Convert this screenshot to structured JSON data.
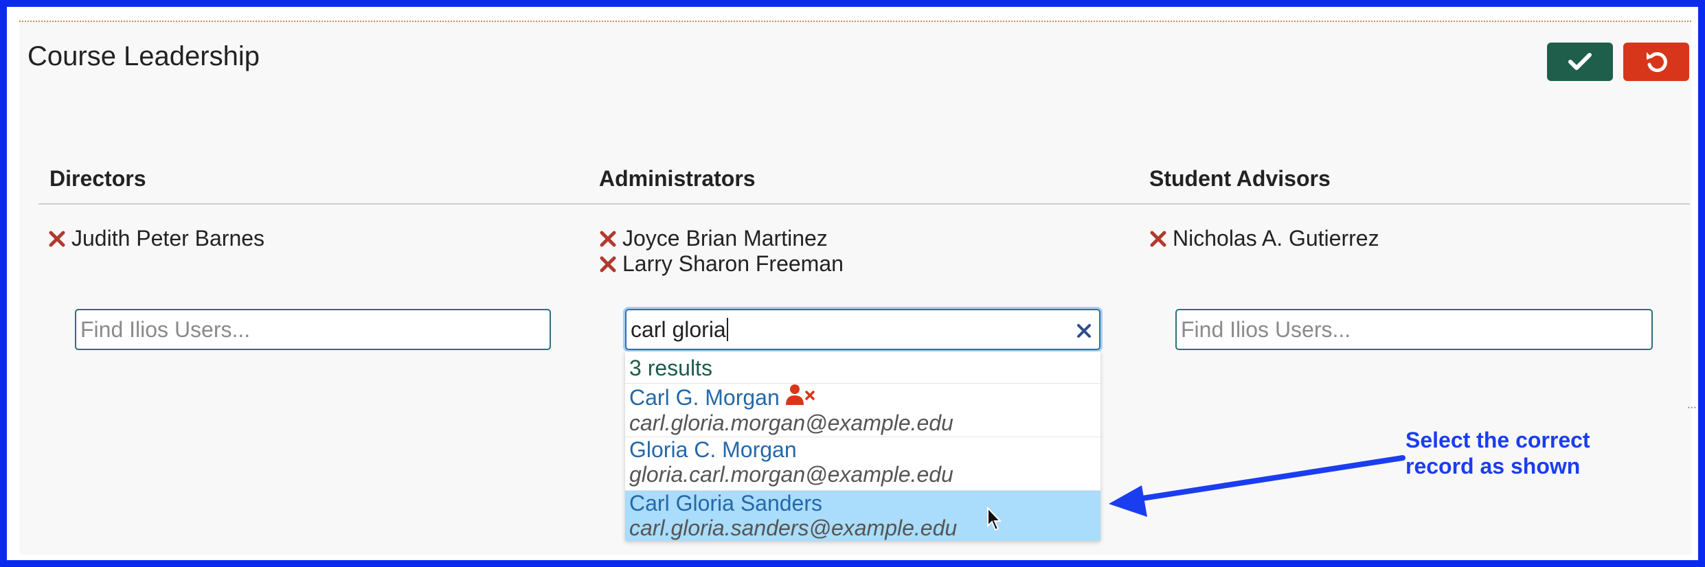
{
  "section": {
    "title": "Course Leadership"
  },
  "toolbar": {
    "save_icon": "check-icon",
    "cancel_icon": "undo-icon"
  },
  "columns": {
    "directors": {
      "heading": "Directors",
      "people": [
        "Judith Peter Barnes"
      ],
      "search_placeholder": "Find Ilios Users..."
    },
    "administrators": {
      "heading": "Administrators",
      "people": [
        "Joyce Brian Martinez",
        "Larry Sharon Freeman"
      ],
      "search_value": "carl gloria"
    },
    "student_advisors": {
      "heading": "Student Advisors",
      "people": [
        "Nicholas A. Gutierrez"
      ],
      "search_placeholder": "Find Ilios Users..."
    }
  },
  "results": {
    "count_text": "3 results",
    "items": [
      {
        "name": "Carl G. Morgan",
        "email": "carl.gloria.morgan@example.edu",
        "disabled_user_icon": true
      },
      {
        "name": "Gloria C. Morgan",
        "email": "gloria.carl.morgan@example.edu"
      },
      {
        "name": "Carl Gloria Sanders",
        "email": "carl.gloria.sanders@example.edu",
        "selected": true
      }
    ]
  },
  "annotation": {
    "line1": "Select the correct",
    "line2": "record as shown"
  },
  "colors": {
    "frame": "#0a2bef",
    "save": "#1f5e4b",
    "cancel": "#d8361a",
    "remove_x": "#b03a2e",
    "link": "#2568a8",
    "selected_row": "#aadcfb"
  }
}
